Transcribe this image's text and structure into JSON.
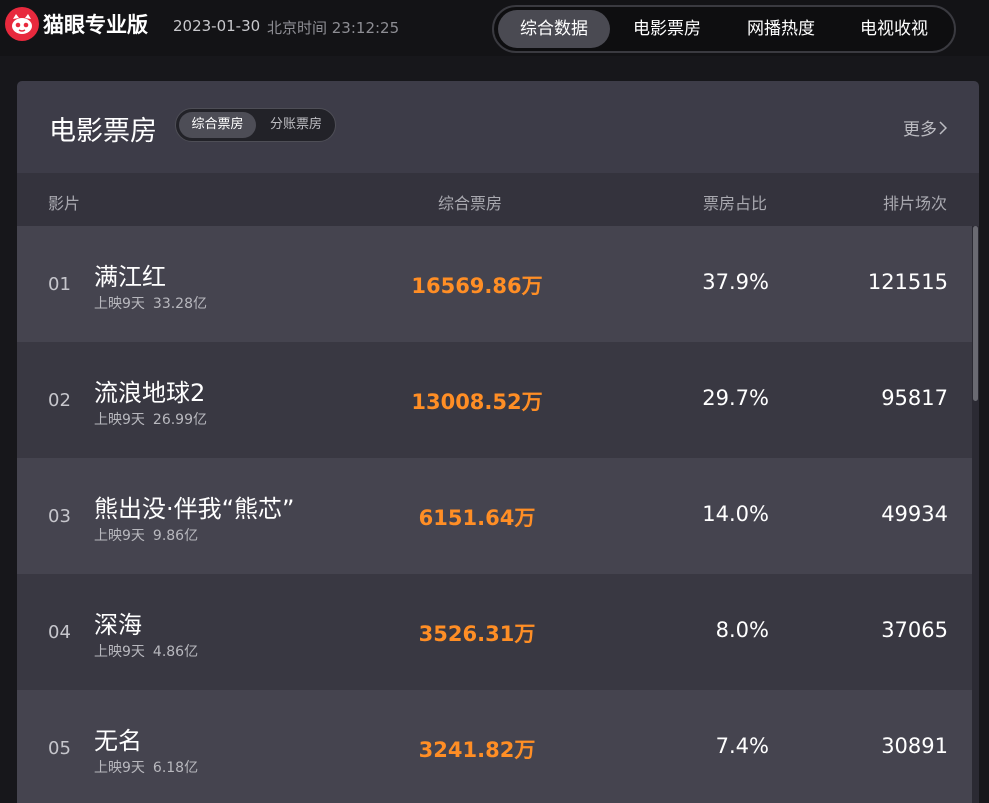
{
  "brand": {
    "name": "猫眼专业版",
    "logo_icon": "cat-face-icon",
    "accent_color": "#e8293d"
  },
  "header": {
    "date": "2023-01-30",
    "clock": "北京时间 23:12:25"
  },
  "nav": {
    "tabs": [
      {
        "label": "综合数据",
        "active": true
      },
      {
        "label": "电影票房",
        "active": false
      },
      {
        "label": "网播热度",
        "active": false
      },
      {
        "label": "电视收视",
        "active": false
      }
    ]
  },
  "panel": {
    "title": "电影票房",
    "segments": [
      {
        "label": "综合票房",
        "active": true
      },
      {
        "label": "分账票房",
        "active": false
      }
    ],
    "more_label": "更多",
    "more_icon": "chevron-right-icon"
  },
  "table": {
    "headers": {
      "film": "影片",
      "box_office": "综合票房",
      "share": "票房占比",
      "shows": "排片场次"
    },
    "highlight_color": "#ff8e25",
    "rows": [
      {
        "rank": "01",
        "name": "满江红",
        "days": "上映9天",
        "total": "33.28亿",
        "box_office": "16569.86万",
        "share": "37.9%",
        "shows": "121515"
      },
      {
        "rank": "02",
        "name": "流浪地球2",
        "days": "上映9天",
        "total": "26.99亿",
        "box_office": "13008.52万",
        "share": "29.7%",
        "shows": "95817"
      },
      {
        "rank": "03",
        "name": "熊出没·伴我“熊芯”",
        "days": "上映9天",
        "total": "9.86亿",
        "box_office": "6151.64万",
        "share": "14.0%",
        "shows": "49934"
      },
      {
        "rank": "04",
        "name": "深海",
        "days": "上映9天",
        "total": "4.86亿",
        "box_office": "3526.31万",
        "share": "8.0%",
        "shows": "37065"
      },
      {
        "rank": "05",
        "name": "无名",
        "days": "上映9天",
        "total": "6.18亿",
        "box_office": "3241.82万",
        "share": "7.4%",
        "shows": "30891"
      }
    ]
  }
}
